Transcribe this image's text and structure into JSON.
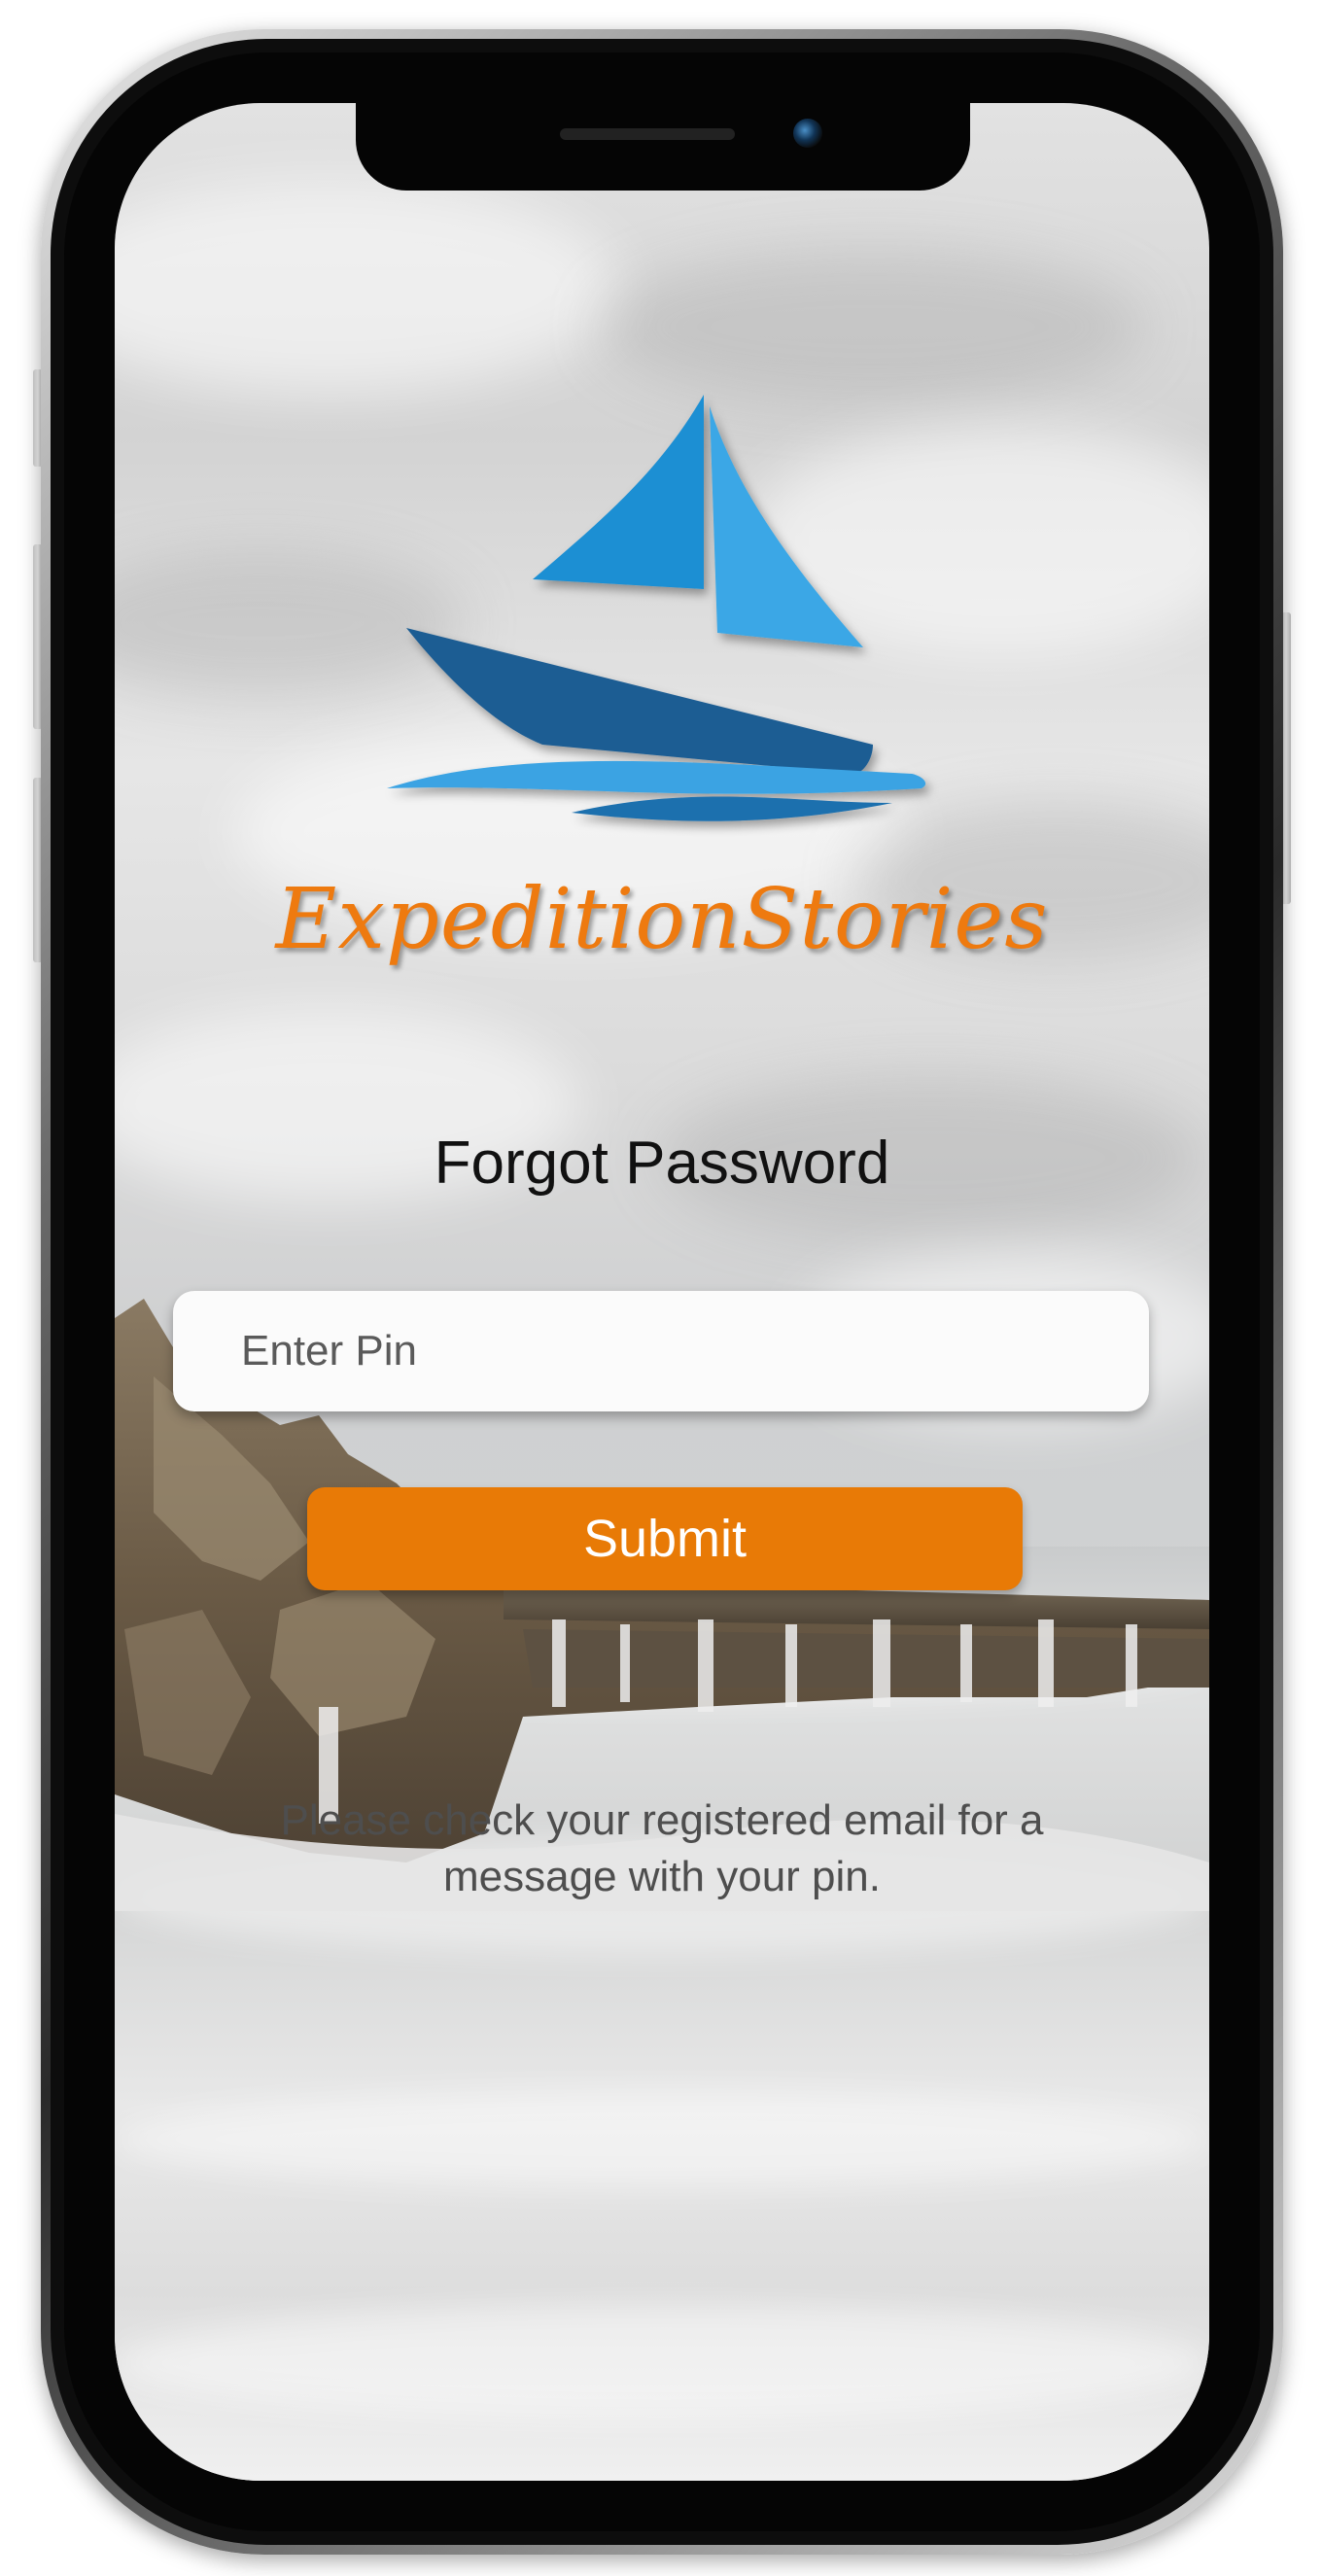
{
  "app": {
    "brand_name": "ExpeditionStories",
    "logo_icon": "sailboat-icon"
  },
  "form": {
    "title": "Forgot Password",
    "pin_placeholder": "Enter Pin",
    "pin_value": "",
    "submit_label": "Submit",
    "hint_text": "Please check your registered email for a message with your pin."
  },
  "colors": {
    "accent": "#e87a06",
    "brand_text": "#ee7a0f",
    "sail_light": "#3aa3e3",
    "sail_dark": "#1e6fae",
    "hull": "#1d5d93"
  }
}
